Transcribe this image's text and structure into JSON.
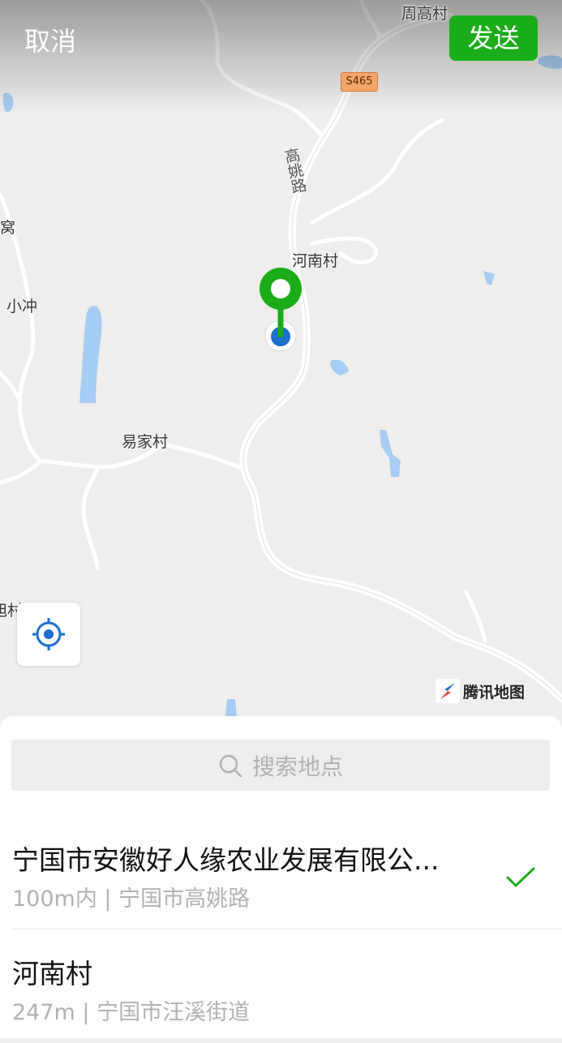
{
  "header": {
    "cancel_label": "取消",
    "send_label": "发送"
  },
  "map": {
    "labels": {
      "zhougao": "周高村",
      "henan": "河南村",
      "xiaochong": "小冲",
      "yijia": "易家村",
      "edge_left_top": "窝",
      "edge_left_bottom": "旭村"
    },
    "road_label": "高姚路",
    "route_shield": "S465",
    "logo_text": "腾讯地图",
    "colors": {
      "pin_green": "#1aad19",
      "location_blue": "#1d6fd0",
      "water": "#a6cdf3"
    }
  },
  "search": {
    "placeholder": "搜索地点"
  },
  "results": [
    {
      "title": "宁国市安徽好人缘农业发展有限公...",
      "subtitle": "100m内 | 宁国市高姚路",
      "selected": true
    },
    {
      "title": "河南村",
      "subtitle": "247m | 宁国市汪溪街道",
      "selected": false
    }
  ]
}
